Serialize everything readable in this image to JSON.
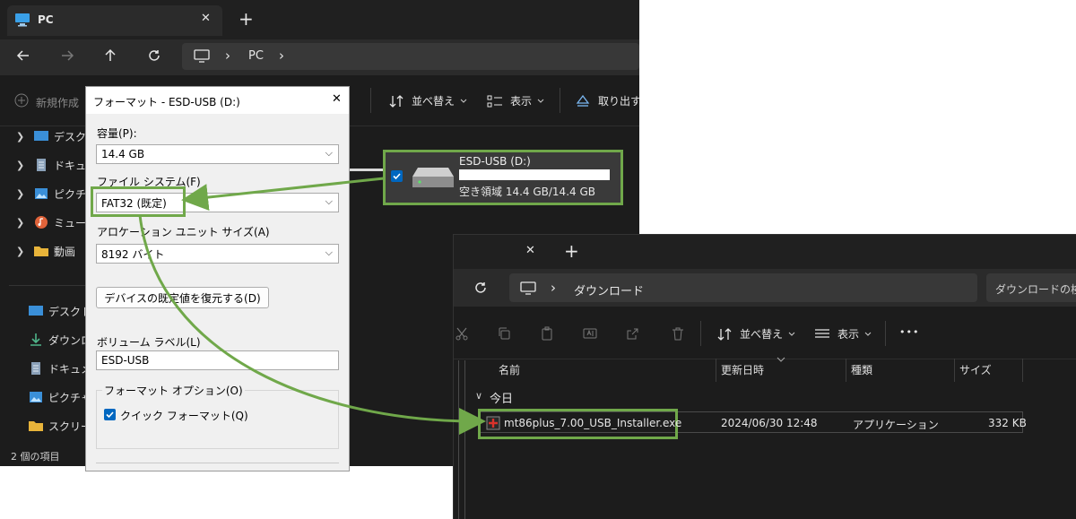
{
  "left_window": {
    "tab_title": "PC",
    "tab_close": "✕",
    "new_tab": "+",
    "address": {
      "root_chevron": "›",
      "segment": "PC",
      "trail_chevron": "›"
    },
    "commands": {
      "new": "新規作成",
      "sort": "並べ替え",
      "view": "表示",
      "eject": "取り出す"
    },
    "sidebar_top": [
      {
        "label": "デスクト",
        "icon": "desktop-icon"
      },
      {
        "label": "ドキュメ",
        "icon": "document-icon"
      },
      {
        "label": "ピクチャ",
        "icon": "picture-icon"
      },
      {
        "label": "ミュージ",
        "icon": "music-icon"
      },
      {
        "label": "動画",
        "icon": "folder-icon"
      }
    ],
    "sidebar_bottom": [
      {
        "label": "デスクトップ",
        "icon": "desktop-icon"
      },
      {
        "label": "ダウンロー",
        "icon": "download-icon"
      },
      {
        "label": "ドキュメン",
        "icon": "document-icon"
      },
      {
        "label": "ピクチャ",
        "icon": "picture-icon"
      },
      {
        "label": "スクリーン",
        "icon": "folder-icon"
      }
    ],
    "status_text": "2 個の項目",
    "drive": {
      "name": "ESD-USB (D:)",
      "free_space": "空き領域 14.4 GB/14.4 GB",
      "used_fraction": 0.0
    }
  },
  "format_dialog": {
    "title": "フォーマット - ESD-USB (D:)",
    "close": "✕",
    "capacity_label": "容量(P):",
    "capacity_value": "14.4 GB",
    "filesystem_label": "ファイル システム(F)",
    "filesystem_value": "FAT32 (既定)",
    "allocation_label": "アロケーション ユニット サイズ(A)",
    "allocation_value": "8192 バイト",
    "restore_button": "デバイスの既定値を復元する(D)",
    "volume_label_label": "ボリューム ラベル(L)",
    "volume_label_value": "ESD-USB",
    "options_group": "フォーマット オプション(O)",
    "quick_format": "クイック フォーマット(Q)",
    "quick_format_checked": true
  },
  "right_window": {
    "tab_close": "✕",
    "new_tab": "+",
    "address": {
      "chevron": "›",
      "segment": "ダウンロード"
    },
    "search_placeholder": "ダウンロードの検",
    "commands": {
      "sort": "並べ替え",
      "view": "表示",
      "more": "•••"
    },
    "columns": {
      "name": "名前",
      "modified": "更新日時",
      "type": "種類",
      "size": "サイズ"
    },
    "group_label": "今日",
    "group_chevron": "∨",
    "rows": [
      {
        "name": "mt86plus_7.00_USB_Installer.exe",
        "modified": "2024/06/30 12:48",
        "type": "アプリケーション",
        "size": "332 KB"
      }
    ]
  },
  "colors": {
    "highlight": "#70a84a",
    "accent": "#0067c0",
    "dark_bg": "#1c1c1c"
  }
}
